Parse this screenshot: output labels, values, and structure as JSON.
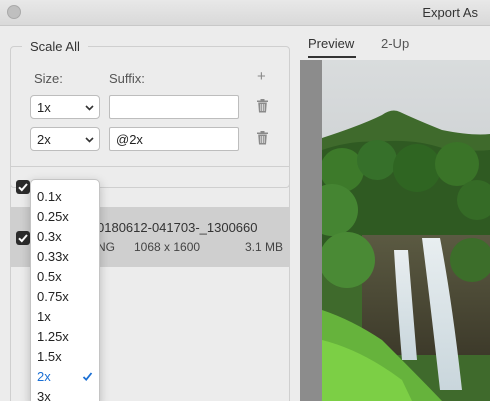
{
  "window": {
    "title": "Export As"
  },
  "scale_all": {
    "group_label": "Scale All",
    "size_label": "Size:",
    "suffix_label": "Suffix:",
    "add_glyph": "+",
    "rows": [
      {
        "size": "1x",
        "suffix": ""
      },
      {
        "size": "2x",
        "suffix": "@2x"
      }
    ]
  },
  "dropdown": {
    "options": [
      "0.1x",
      "0.25x",
      "0.3x",
      "0.33x",
      "0.5x",
      "0.75x",
      "1x",
      "1.25x",
      "1.5x",
      "2x",
      "3x"
    ],
    "selected": "2x"
  },
  "asset": {
    "filename": "0180612-041703-_1300660",
    "format": "NG",
    "dimensions": "1068 x 1600",
    "filesize": "3.1 MB"
  },
  "preview": {
    "tabs": [
      "Preview",
      "2-Up"
    ],
    "active_tab": "Preview"
  }
}
